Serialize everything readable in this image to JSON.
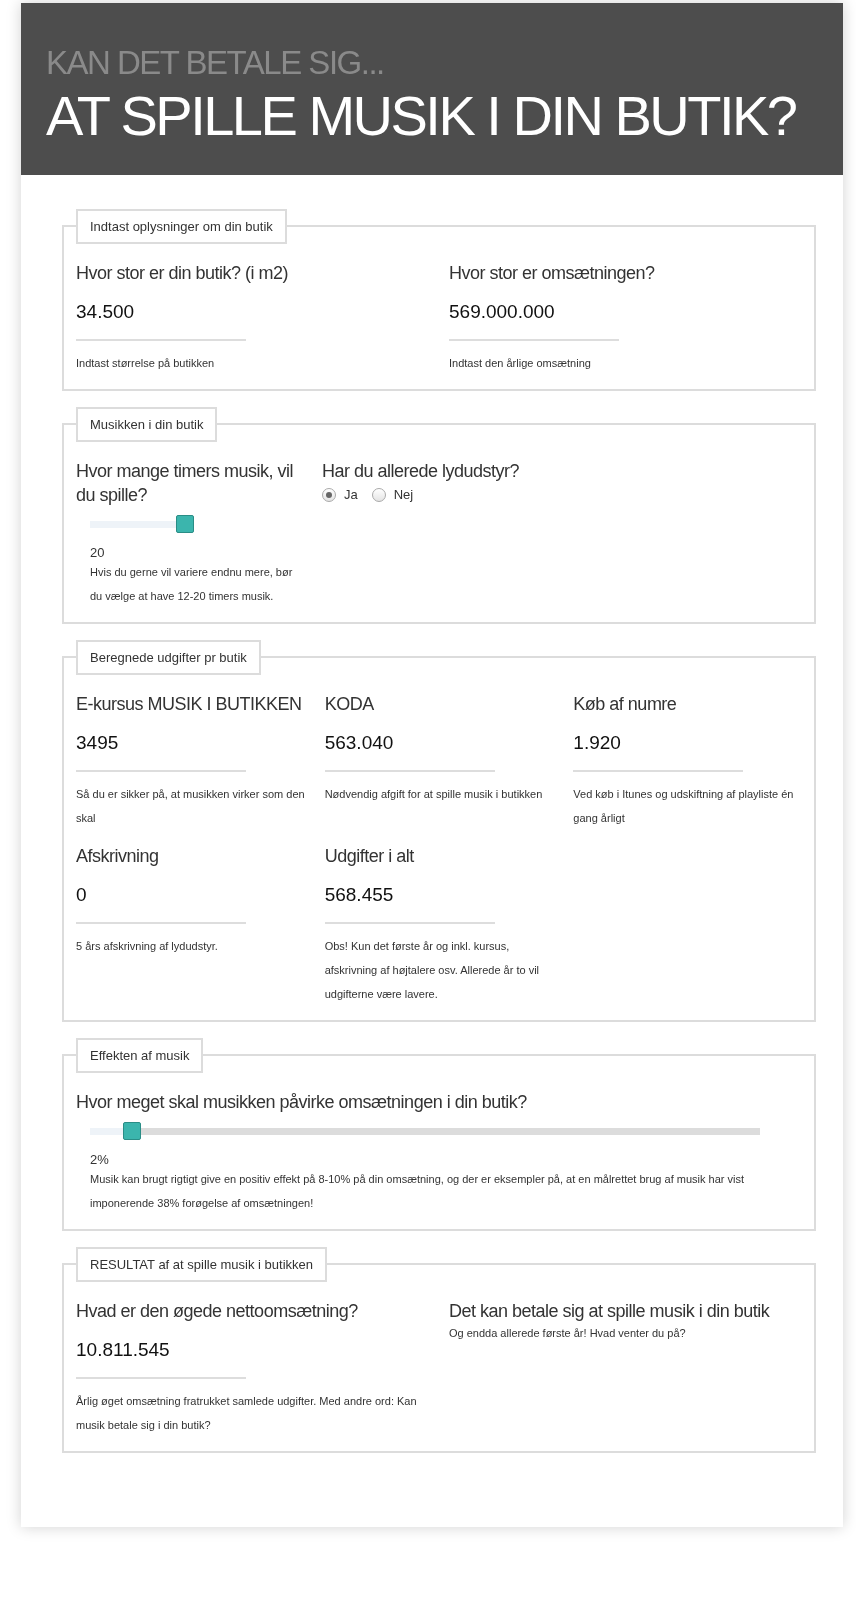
{
  "header": {
    "kicker": "KAN DET BETALE SIG...",
    "title": "AT SPILLE MUSIK I DIN BUTIK?"
  },
  "sections": [
    {
      "legend": "Indtast oplysninger om din butik",
      "kind": "two",
      "items": [
        {
          "kind": "field",
          "label": "Hvor stor er din butik? (i m2)",
          "value": "34.500",
          "help": "Indtast størrelse på butikken"
        },
        {
          "kind": "field",
          "label": "Hvor stor er omsætningen?",
          "value": "569.000.000",
          "help": "Indtast den årlige omsætning"
        }
      ]
    },
    {
      "legend": "Musikken i din butik",
      "kind": "options",
      "items": [
        {
          "kind": "slider",
          "label": "Hvor mange timers musik, vil du spille?",
          "level": 1,
          "reading": "20",
          "help": "Hvis du gerne vil variere endnu mere, bør du vælge at have 12-20 timers musik."
        },
        {
          "kind": "radio",
          "label": "Har du allerede lydudstyr?",
          "options": [
            {
              "label": "Ja",
              "selected": true
            },
            {
              "label": "Nej",
              "selected": false
            }
          ]
        }
      ]
    },
    {
      "legend": "Beregnede udgifter pr butik",
      "kind": "three",
      "items": [
        {
          "kind": "field",
          "label": "E-kursus MUSIK I BUTIKKEN",
          "value": "3495",
          "help": "Så du er sikker på, at musikken virker som den skal"
        },
        {
          "kind": "field",
          "label": "KODA",
          "value": "563.040",
          "help": "Nødvendig afgift for at spille musik i butikken"
        },
        {
          "kind": "field",
          "label": "Køb af numre",
          "value": "1.920",
          "help": "Ved køb i Itunes og udskiftning af playliste én gang årligt"
        },
        {
          "kind": "field",
          "label": "Afskrivning",
          "value": "0",
          "help": "5 års afskrivning af lydudstyr."
        },
        {
          "kind": "field",
          "label": "Udgifter i alt",
          "value": "568.455",
          "help": "Obs! Kun det første år og inkl. kursus, afskrivning af højtalere osv. Allerede år to vil udgifterne være lavere."
        }
      ]
    },
    {
      "legend": "Effekten af musik",
      "kind": "single",
      "items": [
        {
          "kind": "slider",
          "label": "Hvor meget skal musikken påvirke omsætningen i din butik?",
          "level": 0.05,
          "reading": "2%",
          "help": "Musik kan brugt rigtigt give en positiv effekt på 8-10% på din omsætning, og der er eksempler på, at en målrettet brug af musik har vist imponerende 38% forøgelse af omsætningen!"
        }
      ]
    },
    {
      "legend": "RESULTAT af at spille musik i butikken",
      "kind": "two",
      "items": [
        {
          "kind": "field",
          "label": "Hvad er den øgede nettoomsætning?",
          "value": "10.811.545",
          "help": "Årlig øget omsætning fratrukket samlede udgifter. Med andre ord: Kan musik betale sig i din butik?"
        },
        {
          "kind": "note",
          "label": "Det kan betale sig at spille musik i din butik",
          "help": "Og endda allerede første år! Hvad venter du på?"
        }
      ]
    }
  ]
}
